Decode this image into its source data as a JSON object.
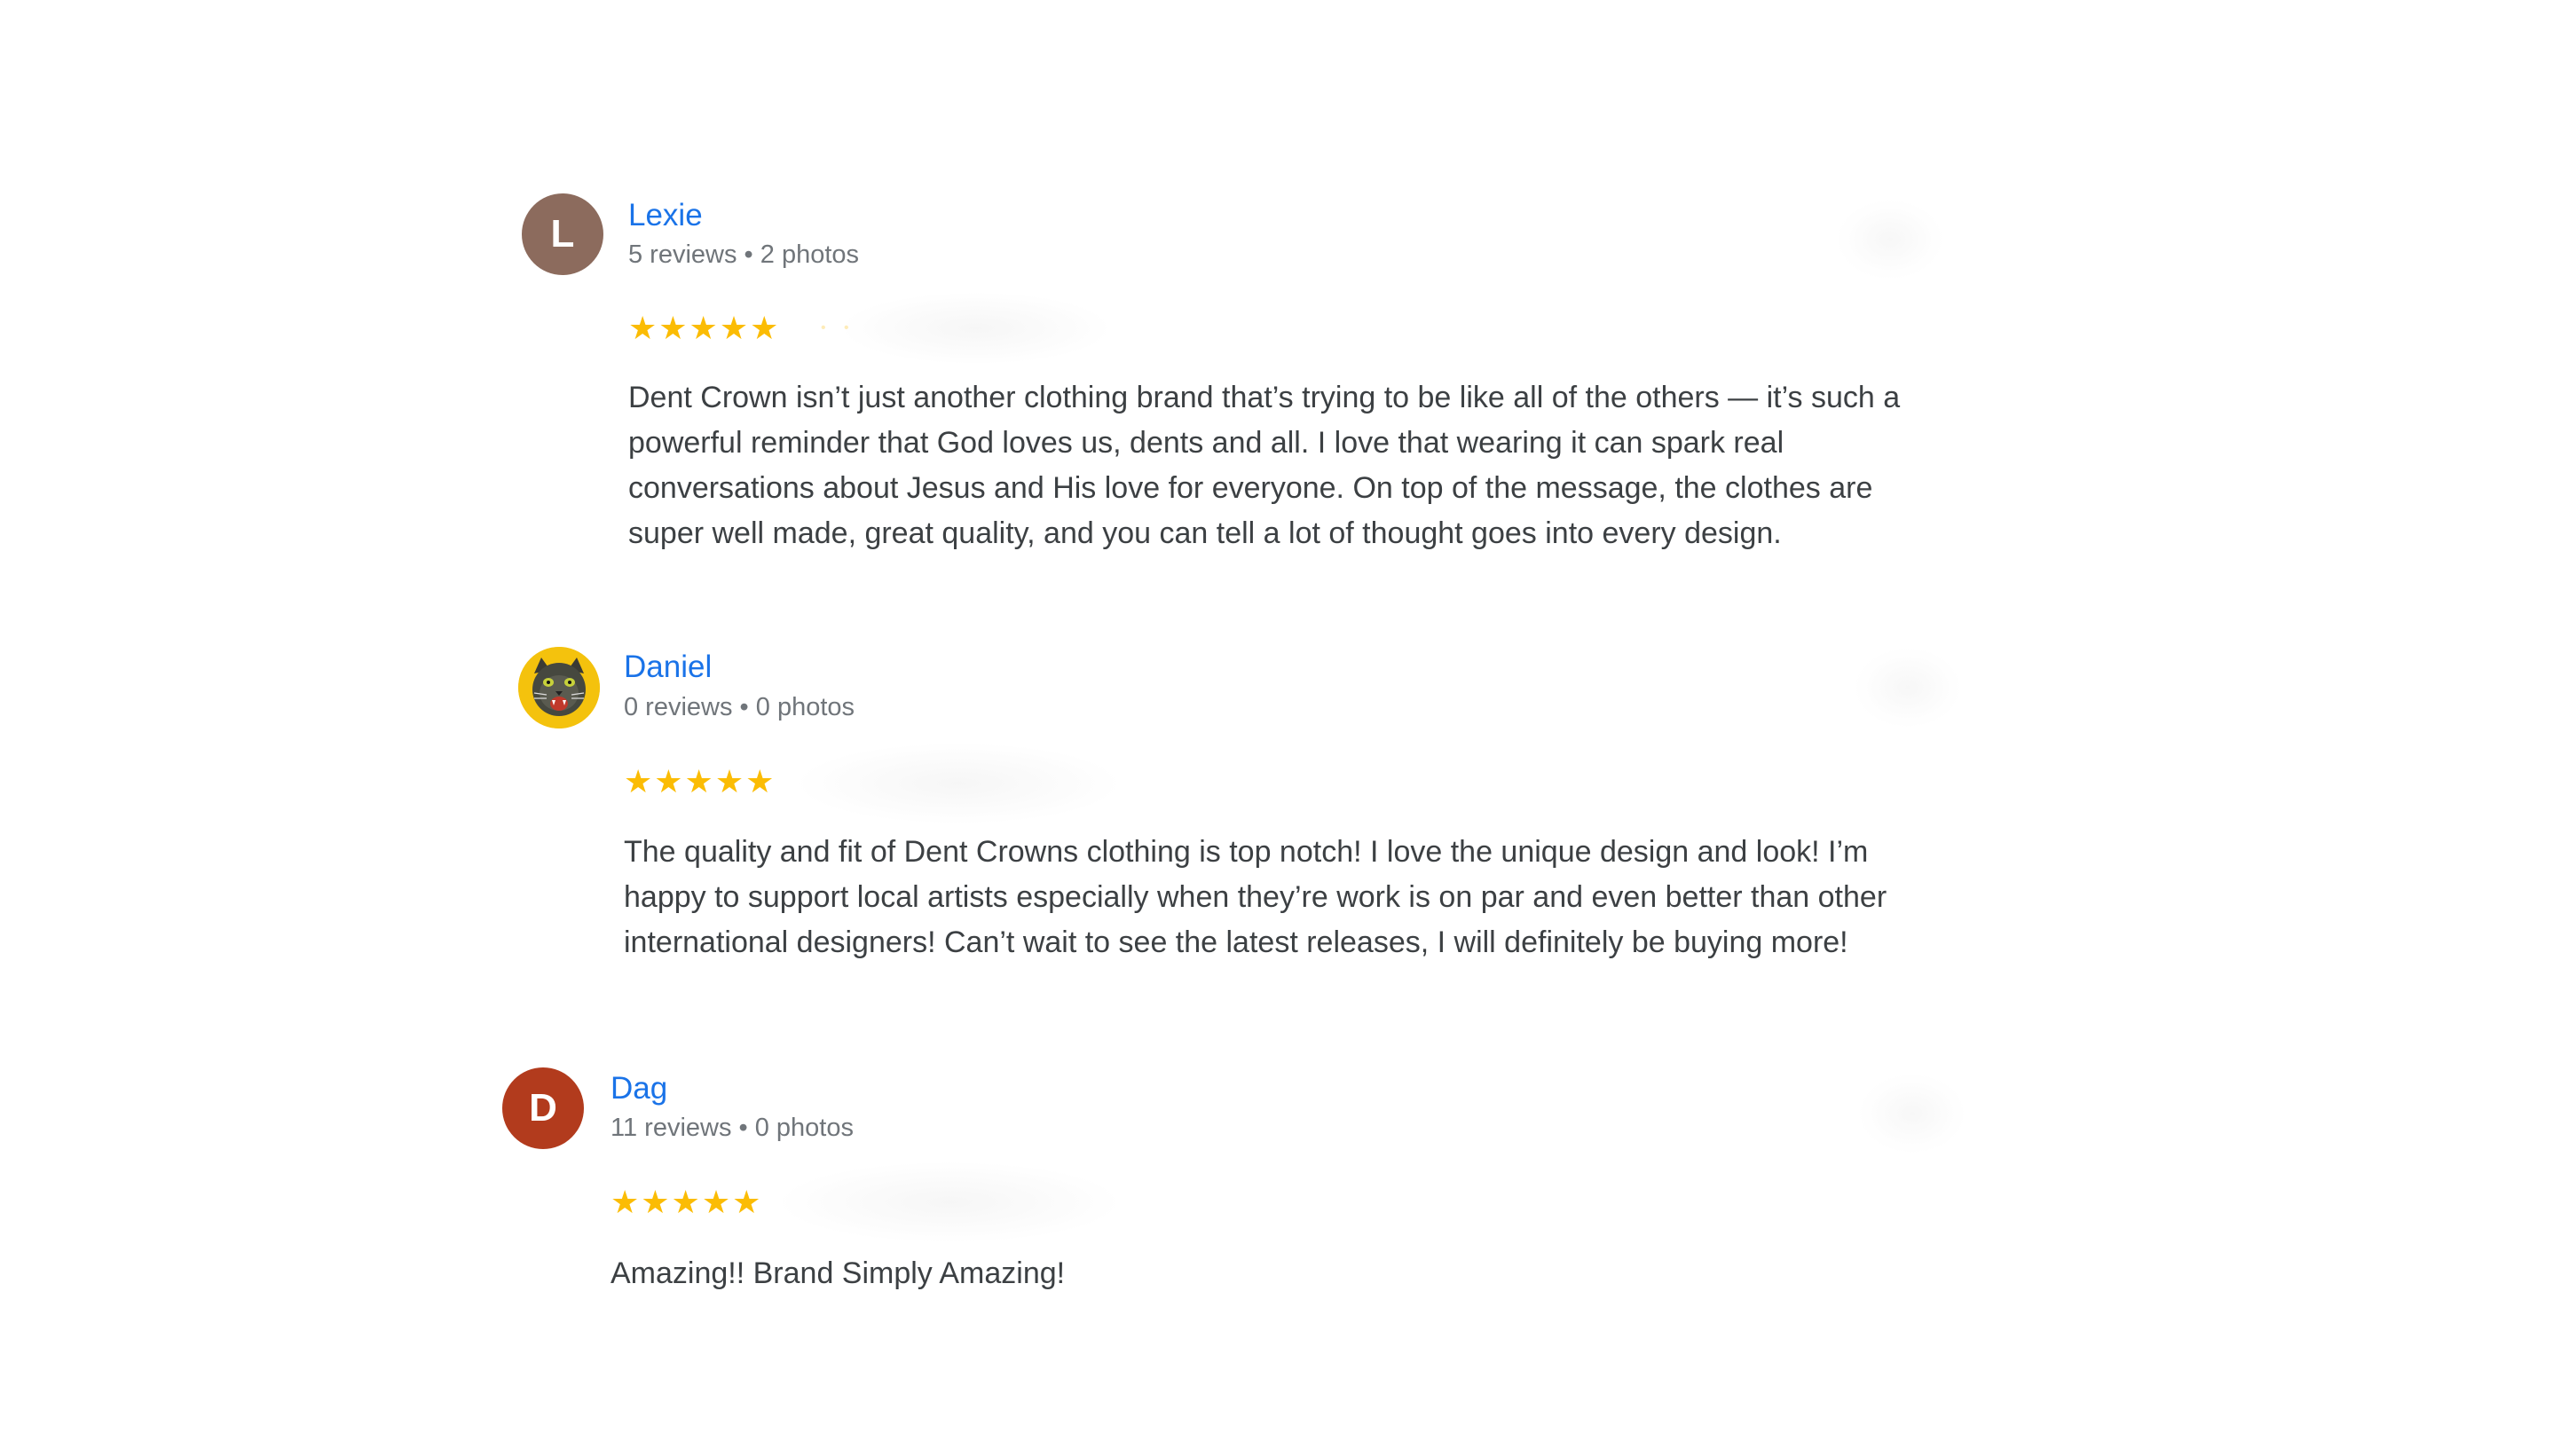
{
  "reviews": [
    {
      "avatar_initial": "L",
      "avatar_color": "#8c6b5d",
      "name": "Lexie",
      "meta": "5 reviews • 2 photos",
      "rating": 5,
      "stars": "★★★★★",
      "text": "Dent Crown isn’t just another clothing brand that’s trying to be like all of the others — it’s such a powerful reminder that God loves us, dents and all. I love that wearing it can spark real conversations about Jesus and His love for everyone. On top of the message, the clothes are super well made, great quality, and you can tell a lot of thought goes into every design."
    },
    {
      "avatar_initial": "",
      "avatar_color": "#f4c20d",
      "avatar_icon": "cat-face-icon",
      "name": "Daniel",
      "meta": "0 reviews • 0 photos",
      "rating": 5,
      "stars": "★★★★★",
      "text": "The quality and fit of Dent Crowns clothing is top notch! I love the unique design and look! I’m happy to support local artists especially when they’re work is on par and even better than other international designers! Can’t wait to see the latest releases, I will definitely be buying more!"
    },
    {
      "avatar_initial": "D",
      "avatar_color": "#b23b1d",
      "name": "Dag",
      "meta": "11 reviews • 0 photos",
      "rating": 5,
      "stars": "★★★★★",
      "text": "Amazing!! Brand Simply Amazing!"
    }
  ],
  "colors": {
    "name_link": "#1a73e8",
    "meta_text": "#70757a",
    "body_text": "#3c4043",
    "star": "#fbbc04"
  }
}
